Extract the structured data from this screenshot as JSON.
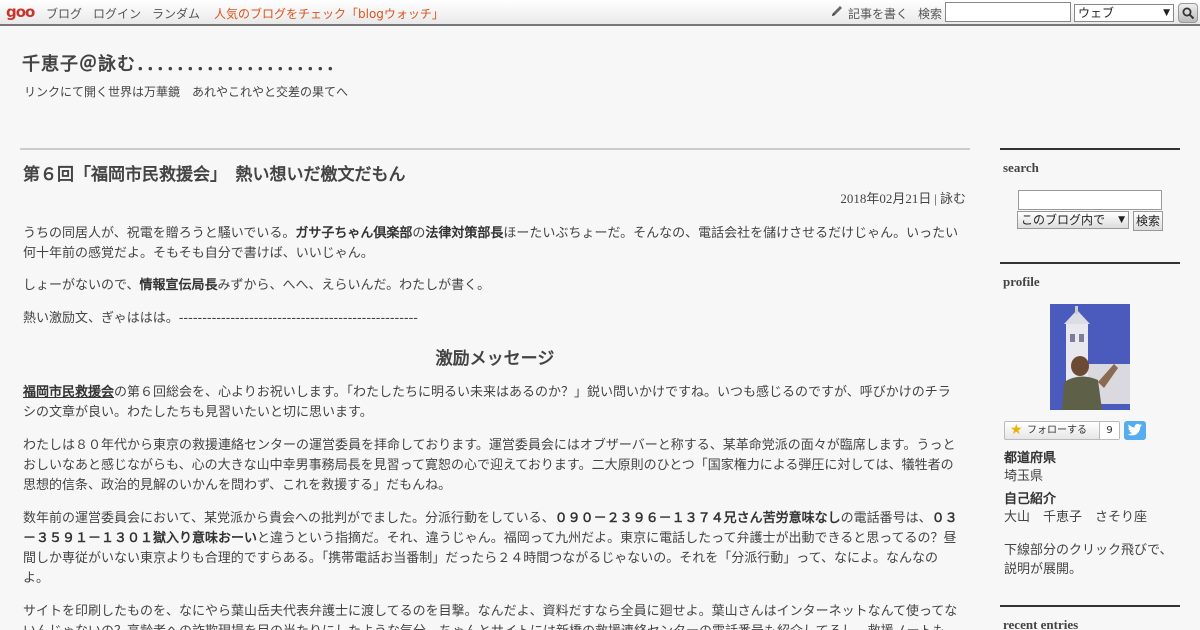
{
  "topbar": {
    "logo": "goo",
    "links": [
      "ブログ",
      "ログイン",
      "ランダム"
    ],
    "promo": "人気のブログをチェック「blogウォッチ」",
    "write_label": "記事を書く",
    "search_label": "検索",
    "search_value": "",
    "scope_selected": "ウェブ"
  },
  "blog": {
    "title": "千恵子＠詠む．．．．．．．．．．．．．．．．．．．．",
    "description": "リンクにて開く世界は万華鏡　あれやこれやと交差の果てへ"
  },
  "post": {
    "title": "第６回「福岡市民救援会」　熱い想いだ檄文だもん",
    "date": "2018年02月21日",
    "category": "詠む",
    "p1_a": "うちの同居人が、祝電を贈ろうと騒いでいる。",
    "p1_b1": "ガサ子ちゃん倶楽部",
    "p1_c": "の",
    "p1_b2": "法律対策部長",
    "p1_d": "ほーたいぶちょーだ。そんなの、電話会社を儲けさせるだけじゃん。いったい何十年前の感覚だよ。そもそも自分で書けば、いいじゃん。",
    "p2_a": "しょーがないので、",
    "p2_b": "情報宣伝局長",
    "p2_c": "みずから、へへ、えらいんだ。わたしが書く。",
    "p3": "熱い激励文、ぎゃははは。---------------------------------------------------",
    "heading": "激励メッセージ",
    "p4_link": "福岡市民救援会",
    "p4_rest": "の第６回総会を、心よりお祝いします。「わたしたちに明るい未来はあるのか？」鋭い問いかけですね。いつも感じるのですが、呼びかけのチラシの文章が良い。わたしたちも見習いたいと切に思います。",
    "p5": "わたしは８０年代から東京の救援連絡センターの運営委員を拝命しております。運営委員会にはオブザーバーと称する、某革命党派の面々が臨席します。うっとおしいなあと感じながらも、心の大きな山中幸男事務局長を見習って寛恕の心で迎えております。二大原則のひとつ「国家権力による弾圧に対しては、犠牲者の思想的信条、政治的見解のいかんを問わず、これを救援する」だもんね。",
    "p6_a": "数年前の運営委員会において、某党派から貴会への批判がでました。分派行動をしている、",
    "p6_b1": "０９０－２３９６－１３７４兄さん苦労意味なし",
    "p6_c": "の電話番号は、",
    "p6_b2": "０３－３５９１－１３０１獄入り意味おーい",
    "p6_d": "と違うという指摘だ。それ、違うじゃん。福岡って九州だよ。東京に電話したって弁護士が出動できると思ってるの？昼間しか専従がいない東京よりも合理的ですらある。「携帯電話お当番制」だったら２４時間つながるじゃないの。それを「分派行動」って、なによ。なんなのよ。",
    "p7": "サイトを印刷したものを、なにやら葉山岳夫代表弁護士に渡してるのを目撃。なんだよ、資料だすなら全員に廻せよ。葉山さんはインターネットなんて使ってないんじゃないの？高齢者への詐欺現場を目の当たりにしたような気分。ちゃんとサイトには新橋の救援連絡センターの電話番号も紹介してるし、救援ノートも"
  },
  "sidebar": {
    "search": {
      "heading": "search",
      "input_value": "",
      "scope_selected": "このブログ内で",
      "button": "検索"
    },
    "profile": {
      "heading": "profile",
      "follow_label": "フォローする",
      "follow_count": "9",
      "pref_label": "都道府県",
      "pref_value": "埼玉県",
      "intro_label": "自己紹介",
      "intro_value": "大山　千恵子　さそり座",
      "note": "下線部分のクリック飛びで、説明が展開。"
    },
    "recent": {
      "heading": "recent entries"
    }
  },
  "colors": {
    "promo": "#d9541e",
    "logo": "#c8342b",
    "twitter": "#55acee"
  }
}
